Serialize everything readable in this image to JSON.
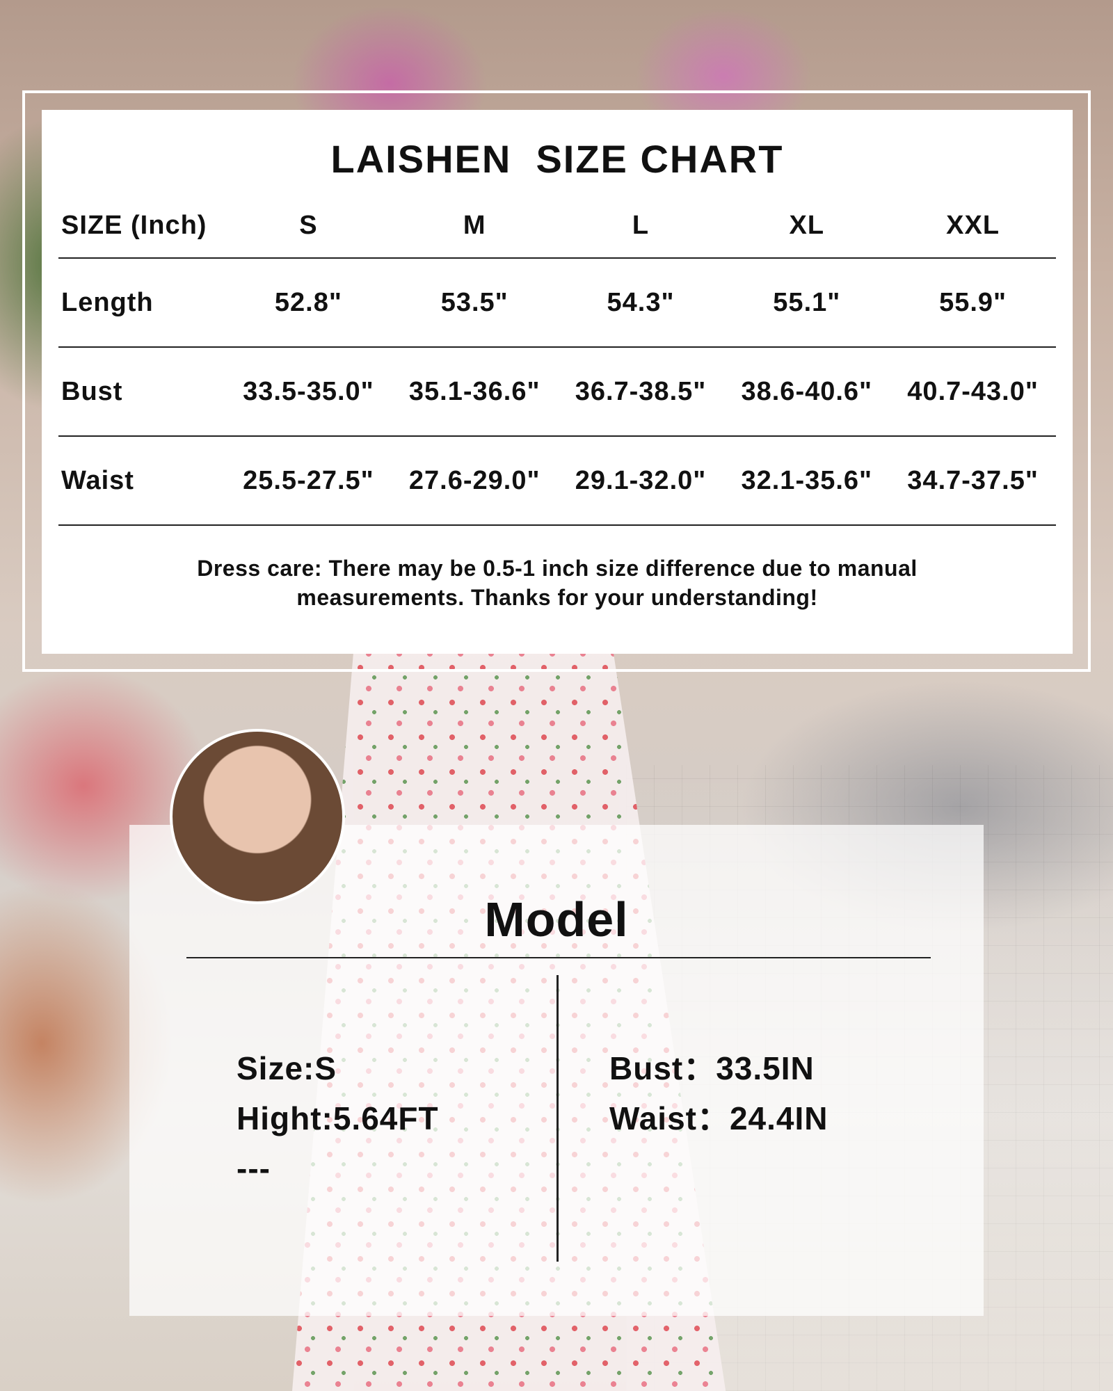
{
  "size_chart": {
    "title": "LAISHEN  SIZE CHART",
    "header": [
      "SIZE (Inch)",
      "S",
      "M",
      "L",
      "XL",
      "XXL"
    ],
    "rows": [
      {
        "label": "Length",
        "values": [
          "52.8\"",
          "53.5\"",
          "54.3\"",
          "55.1\"",
          "55.9\""
        ]
      },
      {
        "label": "Bust",
        "values": [
          "33.5-35.0\"",
          "35.1-36.6\"",
          "36.7-38.5\"",
          "38.6-40.6\"",
          "40.7-43.0\""
        ]
      },
      {
        "label": "Waist",
        "values": [
          "25.5-27.5\"",
          "27.6-29.0\"",
          "29.1-32.0\"",
          "32.1-35.6\"",
          "34.7-37.5\""
        ]
      }
    ],
    "note": {
      "line1": "Dress care: There may be 0.5-1 inch size difference due to manual",
      "line2": "measurements. Thanks for your understanding!"
    }
  },
  "model": {
    "title": "Model",
    "left": {
      "size": "Size:S",
      "height": "Hight:5.64FT",
      "extra": "---"
    },
    "right": {
      "bust": "Bust：33.5IN",
      "waist": "Waist：24.4IN"
    }
  },
  "colors": {
    "card": "#ffffff",
    "text": "#111111",
    "rule": "#222222"
  }
}
